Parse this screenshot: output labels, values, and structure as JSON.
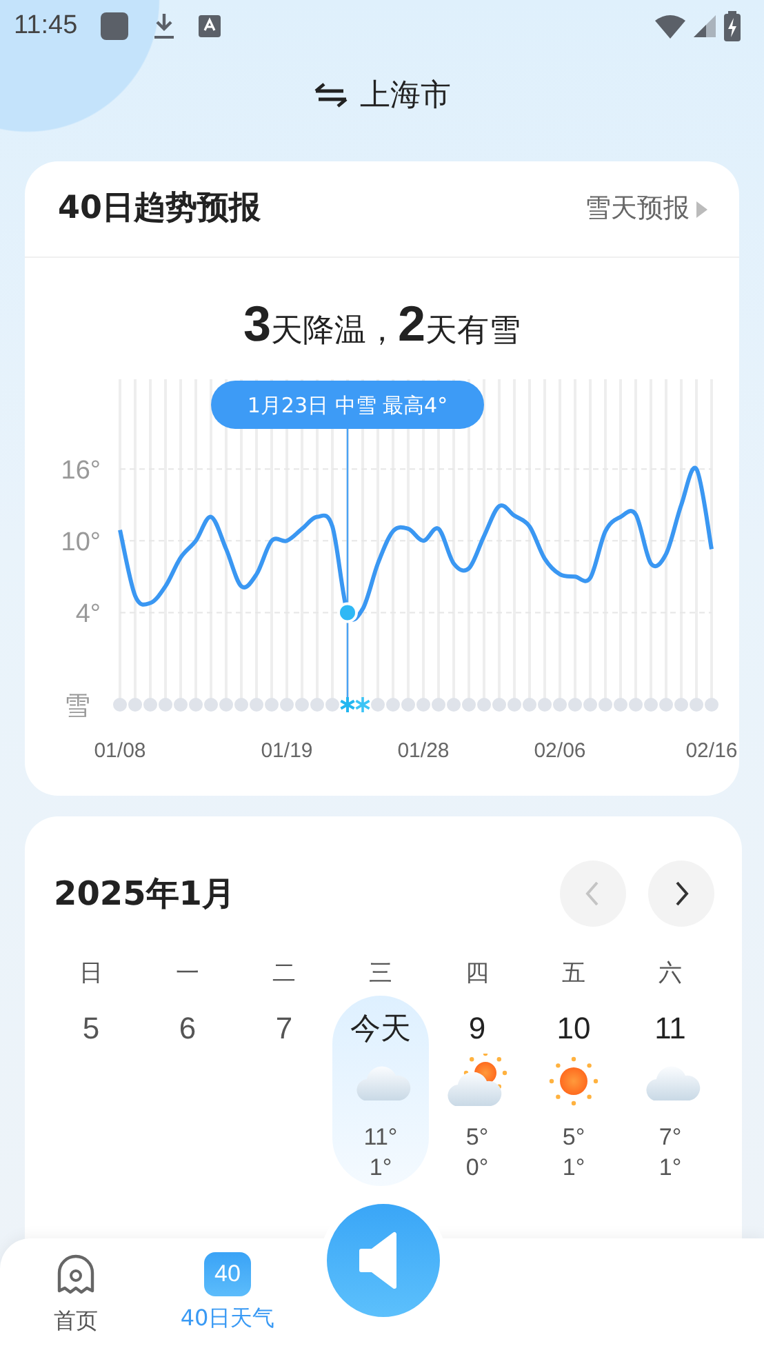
{
  "status_bar": {
    "time": "11:45"
  },
  "header": {
    "city": "上海市"
  },
  "trend_card": {
    "title": "40日趋势预报",
    "link": "雪天预报",
    "headline": "**3**天降温，**2**天有雪",
    "chart_data": {
      "type": "line",
      "categories": [
        "01/08",
        null,
        null,
        null,
        null,
        null,
        null,
        null,
        null,
        null,
        null,
        "01/19",
        null,
        null,
        null,
        null,
        null,
        null,
        null,
        null,
        "01/28",
        null,
        null,
        null,
        null,
        null,
        null,
        null,
        null,
        "02/06",
        null,
        null,
        null,
        null,
        null,
        null,
        null,
        null,
        null,
        "02/16"
      ],
      "series": [
        {
          "color": "#3a97f2",
          "values": [
            10.9,
            5.4,
            4.8,
            6.2,
            8.6,
            10,
            12,
            9.3,
            6.2,
            7.2,
            10,
            10,
            11,
            12,
            11.2,
            4,
            4.3,
            8.1,
            10.8,
            11,
            10,
            11,
            8.1,
            7.7,
            10.4,
            12.9,
            12.1,
            11.2,
            8.5,
            7.2,
            7,
            6.9,
            10.8,
            12,
            12.2,
            8.1,
            8.9,
            13,
            16,
            9.3
          ]
        }
      ],
      "grid": true,
      "ylim": [
        -3.7,
        23.5
      ],
      "yticks": [
        {
          "value": 4,
          "label": "4°"
        },
        {
          "value": 10,
          "label": "10°"
        },
        {
          "value": 16,
          "label": "16°"
        }
      ]
    },
    "tooltip": "1月23日 中雪 最高4°",
    "snow_row": {
      "label": "雪",
      "days": [
        {
          "snow": false,
          "selected": false
        },
        {
          "snow": false,
          "selected": false
        },
        {
          "snow": false,
          "selected": false
        },
        {
          "snow": false,
          "selected": false
        },
        {
          "snow": false,
          "selected": false
        },
        {
          "snow": false,
          "selected": false
        },
        {
          "snow": false,
          "selected": false
        },
        {
          "snow": false,
          "selected": false
        },
        {
          "snow": false,
          "selected": false
        },
        {
          "snow": false,
          "selected": false
        },
        {
          "snow": false,
          "selected": false
        },
        {
          "snow": false,
          "selected": false
        },
        {
          "snow": false,
          "selected": false
        },
        {
          "snow": false,
          "selected": false
        },
        {
          "snow": false,
          "selected": false
        },
        {
          "snow": true,
          "selected": true
        },
        {
          "snow": true,
          "selected": false
        },
        {
          "snow": false,
          "selected": false
        },
        {
          "snow": false,
          "selected": false
        },
        {
          "snow": false,
          "selected": false
        },
        {
          "snow": false,
          "selected": false
        },
        {
          "snow": false,
          "selected": false
        },
        {
          "snow": false,
          "selected": false
        },
        {
          "snow": false,
          "selected": false
        },
        {
          "snow": false,
          "selected": false
        },
        {
          "snow": false,
          "selected": false
        },
        {
          "snow": false,
          "selected": false
        },
        {
          "snow": false,
          "selected": false
        },
        {
          "snow": false,
          "selected": false
        },
        {
          "snow": false,
          "selected": false
        },
        {
          "snow": false,
          "selected": false
        },
        {
          "snow": false,
          "selected": false
        },
        {
          "snow": false,
          "selected": false
        },
        {
          "snow": false,
          "selected": false
        },
        {
          "snow": false,
          "selected": false
        },
        {
          "snow": false,
          "selected": false
        },
        {
          "snow": false,
          "selected": false
        },
        {
          "snow": false,
          "selected": false
        },
        {
          "snow": false,
          "selected": false
        },
        {
          "snow": false,
          "selected": false
        }
      ]
    }
  },
  "calendar": {
    "title": "2025年1月",
    "nav_buttons": [
      {
        "kind": "prev",
        "disabled": true
      },
      {
        "kind": "next",
        "disabled": false
      }
    ],
    "weekdays": [
      "日",
      "一",
      "二",
      "三",
      "四",
      "五",
      "六"
    ],
    "days": [
      {
        "label": "5",
        "past": true,
        "selected": false
      },
      {
        "label": "6",
        "past": true,
        "selected": false
      },
      {
        "label": "7",
        "past": true,
        "selected": false
      },
      {
        "label": "今天",
        "past": false,
        "selected": true,
        "kind": "cloudy",
        "high": "11°",
        "low": "1°"
      },
      {
        "label": "9",
        "past": false,
        "selected": false,
        "kind": "partly_cloudy",
        "high": "5°",
        "low": "0°"
      },
      {
        "label": "10",
        "past": false,
        "selected": false,
        "kind": "sunny",
        "high": "5°",
        "low": "1°"
      },
      {
        "label": "11",
        "past": false,
        "selected": false,
        "kind": "cloudy",
        "high": "7°",
        "low": "1°"
      }
    ]
  },
  "bottom_nav": {
    "tabs": [
      {
        "kind": "home",
        "label": "首页",
        "selected": false
      },
      {
        "kind": "forty",
        "label": "40日天气",
        "icon_text": "40",
        "selected": true
      }
    ]
  }
}
